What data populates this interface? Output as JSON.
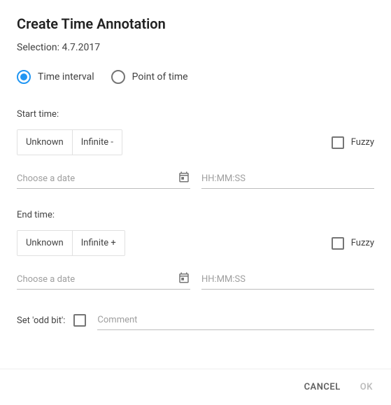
{
  "title": "Create Time Annotation",
  "selection": {
    "label": "Selection:",
    "value": "4.7.2017"
  },
  "radios": {
    "interval": "Time interval",
    "point": "Point of time"
  },
  "start": {
    "label": "Start time:",
    "unknown": "Unknown",
    "infinite": "Infinite -",
    "fuzzy": "Fuzzy",
    "date_placeholder": "Choose a date",
    "time_placeholder": "HH:MM:SS"
  },
  "end": {
    "label": "End time:",
    "unknown": "Unknown",
    "infinite": "Infinite +",
    "fuzzy": "Fuzzy",
    "date_placeholder": "Choose a date",
    "time_placeholder": "HH:MM:SS"
  },
  "oddbit": {
    "label": "Set 'odd bit':",
    "comment_placeholder": "Comment"
  },
  "actions": {
    "cancel": "CANCEL",
    "ok": "OK"
  }
}
